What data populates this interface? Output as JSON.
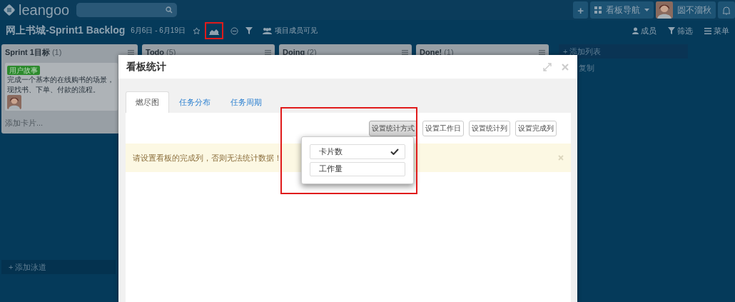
{
  "topbar": {
    "logo": "leangoo",
    "add": "+",
    "nav": "看板导航",
    "user": "圆不溜秋"
  },
  "board": {
    "title": "网上书城-Sprint1 Backlog",
    "dates": "6月6日 - 6月19日",
    "icons": [
      {
        "kind": "star",
        "highlighted": false
      },
      {
        "kind": "chart",
        "highlighted": true
      },
      {
        "kind": "minus",
        "highlighted": false
      },
      {
        "kind": "filter",
        "highlighted": false
      }
    ],
    "visibility": "项目成员可见",
    "actions": [
      {
        "kind": "person",
        "label": "成员"
      },
      {
        "kind": "filter",
        "label": "筛选"
      },
      {
        "kind": "menu",
        "label": "菜单"
      }
    ]
  },
  "lists": [
    {
      "title": "Sprint 1目标",
      "count": "(1)",
      "cards": [
        {
          "tag": "用户故事",
          "lines": [
            "完成一个基本的在线购书的场景，",
            "现找书、下单、付款的流程。"
          ]
        }
      ],
      "add_card": "添加卡片..."
    },
    {
      "title": "Todo",
      "count": "(5)"
    },
    {
      "title": "Doing",
      "count": "(2)"
    },
    {
      "title": "Done!",
      "count": "(1)"
    }
  ],
  "add_list": "+ 添加列表",
  "copy": "复制",
  "add_lane": "+ 添加泳道",
  "modal": {
    "title": "看板统计",
    "tabs": [
      {
        "label": "燃尽图",
        "selected": true
      },
      {
        "label": "任务分布",
        "selected": false
      },
      {
        "label": "任务周期",
        "selected": false
      }
    ],
    "buttons": [
      {
        "label": "设置统计方式",
        "pressed": true
      },
      {
        "label": "设置工作日",
        "pressed": false
      },
      {
        "label": "设置统计列",
        "pressed": false
      },
      {
        "label": "设置完成列",
        "pressed": false
      }
    ],
    "alert": "请设置看板的完成列，否则无法统计数据！",
    "menu": [
      {
        "label": "卡片数",
        "checked": true
      },
      {
        "label": "工作量",
        "checked": false
      }
    ],
    "menu_highlighted": true
  }
}
